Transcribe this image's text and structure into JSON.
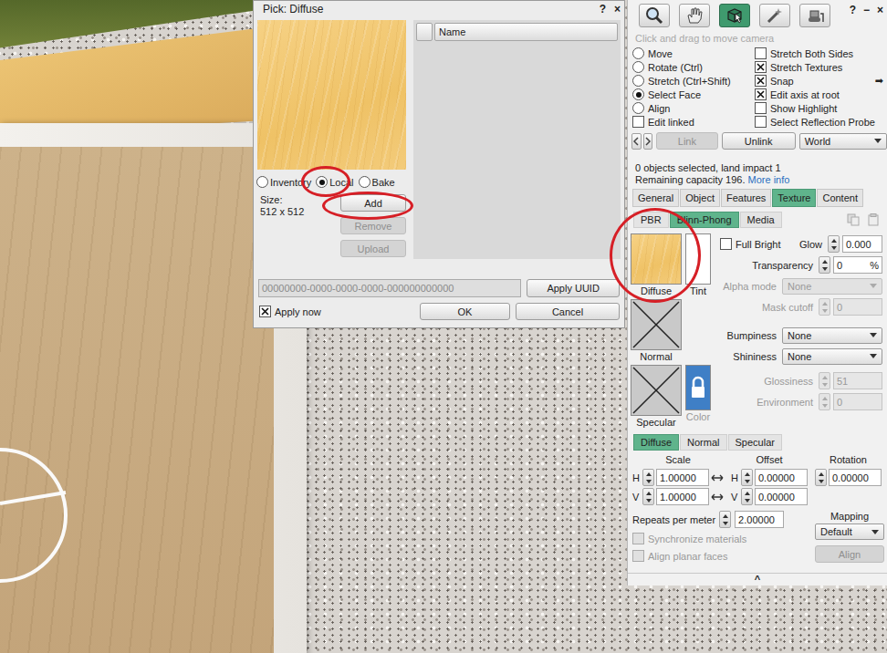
{
  "dialog": {
    "title": "Pick: Diffuse",
    "controls": [
      "?",
      "×"
    ],
    "sources": [
      {
        "label": "Inventory",
        "selected": false
      },
      {
        "label": "Local",
        "selected": true
      },
      {
        "label": "Bake",
        "selected": false
      }
    ],
    "size_label": "Size:",
    "size_value": "512 x 512",
    "actions": [
      {
        "label": "Add",
        "disabled": false
      },
      {
        "label": "Remove",
        "disabled": true
      },
      {
        "label": "Upload",
        "disabled": true
      }
    ],
    "list_header": "Name",
    "uuid": "00000000-0000-0000-0000-000000000000",
    "apply_uuid": "Apply UUID",
    "apply_now": {
      "label": "Apply now",
      "checked": true
    },
    "buttons": [
      "OK",
      "Cancel"
    ]
  },
  "tools": {
    "controls": [
      "?",
      "−",
      "×"
    ],
    "toolbar": [
      {
        "kind": "zoom",
        "selected": false
      },
      {
        "kind": "grab",
        "selected": false
      },
      {
        "kind": "edit",
        "selected": true
      },
      {
        "kind": "create",
        "selected": false
      },
      {
        "kind": "land",
        "selected": false
      }
    ],
    "hint": "Click and drag to move camera",
    "modes": [
      {
        "label": "Move",
        "selected": false
      },
      {
        "label": "Rotate (Ctrl)",
        "selected": false
      },
      {
        "label": "Stretch (Ctrl+Shift)",
        "selected": false
      },
      {
        "label": "Select Face",
        "selected": true
      },
      {
        "label": "Align",
        "selected": false
      }
    ],
    "edit_linked": {
      "label": "Edit linked",
      "checked": false
    },
    "options": [
      {
        "label": "Stretch Both Sides",
        "checked": false
      },
      {
        "label": "Stretch Textures",
        "checked": true
      },
      {
        "label": "Snap",
        "checked": true,
        "arrow": "➡"
      },
      {
        "label": "Edit axis at root",
        "checked": true
      },
      {
        "label": "Show Highlight",
        "checked": false
      },
      {
        "label": "Select Reflection Probe",
        "checked": false
      }
    ],
    "link": {
      "label": "Link",
      "disabled": true
    },
    "unlink": {
      "label": "Unlink",
      "disabled": false
    },
    "frame": "World",
    "status": "0 objects selected, land impact 1",
    "capacity": "Remaining capacity 196.",
    "more_info": "More info",
    "tabs": [
      {
        "label": "General",
        "selected": false
      },
      {
        "label": "Object",
        "selected": false
      },
      {
        "label": "Features",
        "selected": false
      },
      {
        "label": "Texture",
        "selected": true
      },
      {
        "label": "Content",
        "selected": false
      }
    ],
    "subtabs": [
      {
        "label": "PBR",
        "selected": false
      },
      {
        "label": "Blinn-Phong",
        "selected": true
      },
      {
        "label": "Media",
        "selected": false
      }
    ],
    "texture": {
      "maps": [
        {
          "label": "Diffuse",
          "kind": "texture",
          "side": {
            "label": "Tint",
            "kind": "tint",
            "disabled": false
          }
        },
        {
          "label": "Normal",
          "kind": "none"
        },
        {
          "label": "Specular",
          "kind": "none",
          "side": {
            "label": "Color",
            "kind": "locked",
            "disabled": true
          }
        }
      ],
      "full_bright": {
        "label": "Full Bright",
        "checked": false
      },
      "glow": {
        "label": "Glow",
        "value": "0.000"
      },
      "transparency": {
        "label": "Transparency",
        "value": "0",
        "unit": "%"
      },
      "alpha_mode": {
        "label": "Alpha mode",
        "value": "None",
        "disabled": true
      },
      "mask_cutoff": {
        "label": "Mask cutoff",
        "value": "0",
        "disabled": true
      },
      "bumpiness": {
        "label": "Bumpiness",
        "value": "None"
      },
      "shininess": {
        "label": "Shininess",
        "value": "None"
      },
      "glossiness": {
        "label": "Glossiness",
        "value": "51",
        "disabled": true
      },
      "environment": {
        "label": "Environment",
        "value": "0",
        "disabled": true
      },
      "map_tabs": [
        {
          "label": "Diffuse",
          "selected": true
        },
        {
          "label": "Normal",
          "selected": false
        },
        {
          "label": "Specular",
          "selected": false
        }
      ],
      "axis_labels": [
        "H",
        "V"
      ],
      "scale": {
        "label": "Scale",
        "h": "1.00000",
        "v": "1.00000"
      },
      "offset": {
        "label": "Offset",
        "h": "0.00000",
        "v": "0.00000"
      },
      "rotation": {
        "label": "Rotation",
        "value": "0.00000"
      },
      "repeats": {
        "label": "Repeats per meter",
        "value": "2.00000"
      },
      "mapping": {
        "label": "Mapping",
        "value": "Default"
      },
      "sync": {
        "label": "Synchronize materials",
        "checked": false,
        "disabled": true
      },
      "align_planar": {
        "label": "Align planar faces",
        "checked": false,
        "disabled": true
      },
      "align_button": {
        "label": "Align",
        "disabled": true
      },
      "collapse": "^"
    }
  }
}
